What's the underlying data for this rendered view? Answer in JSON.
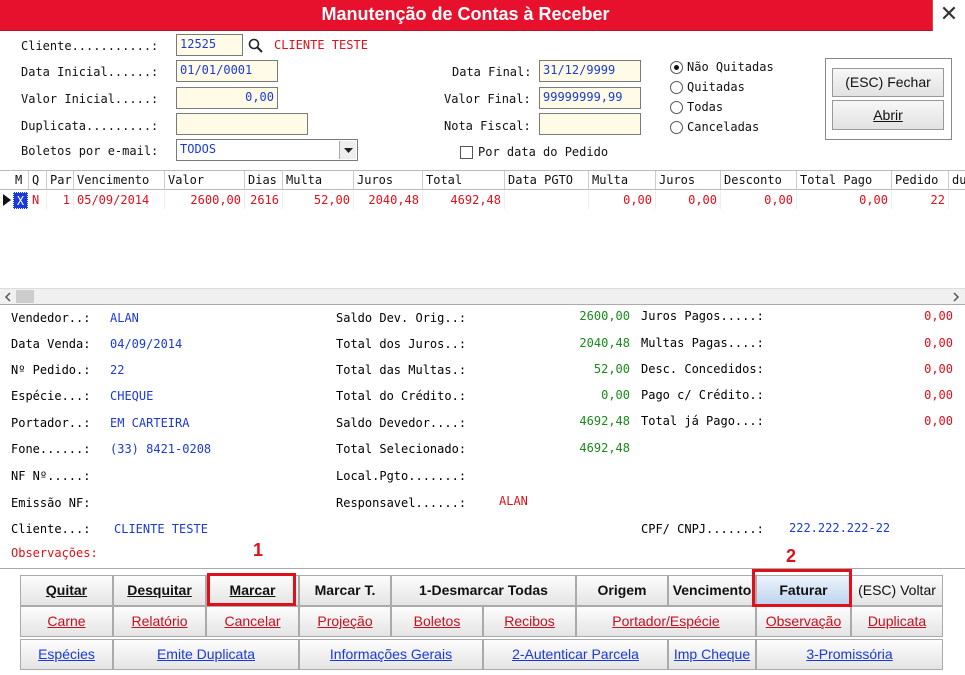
{
  "window": {
    "title": "Manutenção de Contas à Receber",
    "close_glyph": "✕"
  },
  "filters": {
    "cliente_label": "Cliente...........:",
    "cliente_code": "12525",
    "cliente_name": "CLIENTE TESTE",
    "data_inicial_label": "Data Inicial......:",
    "data_inicial": "01/01/0001",
    "valor_inicial_label": "Valor Inicial.....:",
    "valor_inicial": "0,00",
    "duplicata_label": "Duplicata.........:",
    "duplicata": "",
    "boletos_label": "Boletos por e-mail:",
    "boletos_value": "TODOS",
    "data_final_label": "Data Final:",
    "data_final": "31/12/9999",
    "valor_final_label": "Valor Final:",
    "valor_final": "99999999,99",
    "nota_fiscal_label": "Nota Fiscal:",
    "nota_fiscal": "",
    "por_data_pedido": "Por data do Pedido",
    "status_options": [
      "Não Quitadas",
      "Quitadas",
      "Todas",
      "Canceladas"
    ]
  },
  "actions": {
    "fechar": "(ESC) Fechar",
    "abrir": "Abrir"
  },
  "grid": {
    "headers": [
      "M",
      "Q",
      "Par",
      "Vencimento",
      "Valor",
      "Dias",
      "Multa",
      "Juros",
      "Total",
      "Data PGTO",
      "Multa",
      "Juros",
      "Desconto",
      "Total Pago",
      "Pedido",
      "du"
    ],
    "row": {
      "m": "X",
      "q": "N",
      "par": "1",
      "vencimento": "05/09/2014",
      "valor": "2600,00",
      "dias": "2616",
      "multa": "52,00",
      "juros": "2040,48",
      "total": "4692,48",
      "data_pgto": "",
      "multa2": "0,00",
      "juros2": "0,00",
      "desconto": "0,00",
      "total_pago": "0,00",
      "pedido": "22"
    }
  },
  "details": {
    "vendedor_label": "Vendedor..:",
    "vendedor": "ALAN",
    "data_venda_label": "Data Venda:",
    "data_venda": "04/09/2014",
    "pedido_label": "Nº Pedido.:",
    "pedido": "22",
    "especie_label": "Espécie...:",
    "especie": "CHEQUE",
    "portador_label": "Portador..:",
    "portador": "EM CARTEIRA",
    "fone_label": "Fone......:",
    "fone": "(33) 8421-0208",
    "nf_label": "NF Nº.....:",
    "emissao_label": "Emissão NF:",
    "cliente_label": "Cliente...:",
    "cliente": "CLIENTE TESTE",
    "obs_label": "Observações:",
    "saldo_orig_label": "Saldo Dev. Orig..:",
    "saldo_orig": "2600,00",
    "total_juros_label": "Total dos Juros..:",
    "total_juros": "2040,48",
    "total_multas_label": "Total das Multas.:",
    "total_multas": "52,00",
    "total_credito_label": "Total do Crédito.:",
    "total_credito": "0,00",
    "saldo_devedor_label": "Saldo Devedor....:",
    "saldo_devedor": "4692,48",
    "total_sel_label": "Total Selecionado:",
    "total_sel": "4692,48",
    "local_pgto_label": "Local.Pgto.......:",
    "responsavel_label": "Responsavel......:",
    "responsavel": "ALAN",
    "juros_pagos_label": "Juros Pagos.....:",
    "juros_pagos": "0,00",
    "multas_pagas_label": "Multas Pagas....:",
    "multas_pagas": "0,00",
    "desc_label": "Desc. Concedidos:",
    "desc": "0,00",
    "pago_credito_label": "Pago c/ Crédito.:",
    "pago_credito": "0,00",
    "total_pago_label": "Total já Pago...:",
    "total_pago": "0,00",
    "cpf_label": "CPF/ CNPJ.......:",
    "cpf": "222.222.222-22"
  },
  "toolbar1": [
    "Quitar",
    "Desquitar",
    "Marcar",
    "Marcar T.",
    "1-Desmarcar Todas",
    "Origem",
    "Vencimento",
    "Faturar",
    "(ESC) Voltar"
  ],
  "toolbar2": [
    "Carne",
    "Relatório",
    "Cancelar",
    "Projeção",
    "Boletos",
    "Recibos",
    "Portador/Espécie",
    "Observação",
    "Duplicata"
  ],
  "toolbar3": [
    "Espécies",
    "Emite Duplicata",
    "Informações Gerais",
    "2-Autenticar Parcela",
    "Imp Cheque",
    "3-Promissória"
  ],
  "annotations": [
    "1",
    "2"
  ],
  "colors": {
    "title_bar": "#e8112d",
    "highlight": "#e0101a"
  }
}
